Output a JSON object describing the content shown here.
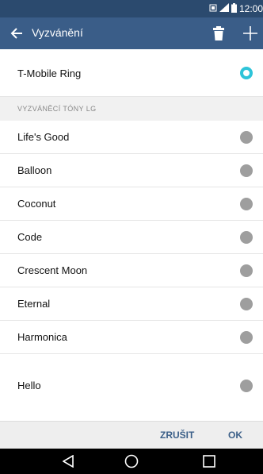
{
  "status": {
    "time": "12:00",
    "icons": [
      "sim-icon",
      "signal-icon",
      "battery-icon"
    ]
  },
  "appbar": {
    "title": "Vyzvánění",
    "back_icon": "back-arrow-icon",
    "delete_icon": "trash-icon",
    "add_icon": "plus-icon"
  },
  "current": {
    "label": "T-Mobile Ring",
    "selected": true
  },
  "section": {
    "header": "VYZVÁNĚCÍ TÓNY LG"
  },
  "ringtones": [
    {
      "label": "Life's Good",
      "selected": false
    },
    {
      "label": "Balloon",
      "selected": false
    },
    {
      "label": "Coconut",
      "selected": false
    },
    {
      "label": "Code",
      "selected": false
    },
    {
      "label": "Crescent Moon",
      "selected": false
    },
    {
      "label": "Eternal",
      "selected": false
    },
    {
      "label": "Harmonica",
      "selected": false
    },
    {
      "label": "Hello",
      "selected": false
    }
  ],
  "actions": {
    "cancel": "ZRUŠIT",
    "ok": "OK"
  },
  "colors": {
    "statusbar": "#2b4a6e",
    "appbar": "#3a5d88",
    "accent": "#2ec4d9",
    "radio_off": "#9e9e9e"
  },
  "navbar": {
    "icons": [
      "back-triangle-icon",
      "home-circle-icon",
      "recents-square-icon"
    ]
  }
}
